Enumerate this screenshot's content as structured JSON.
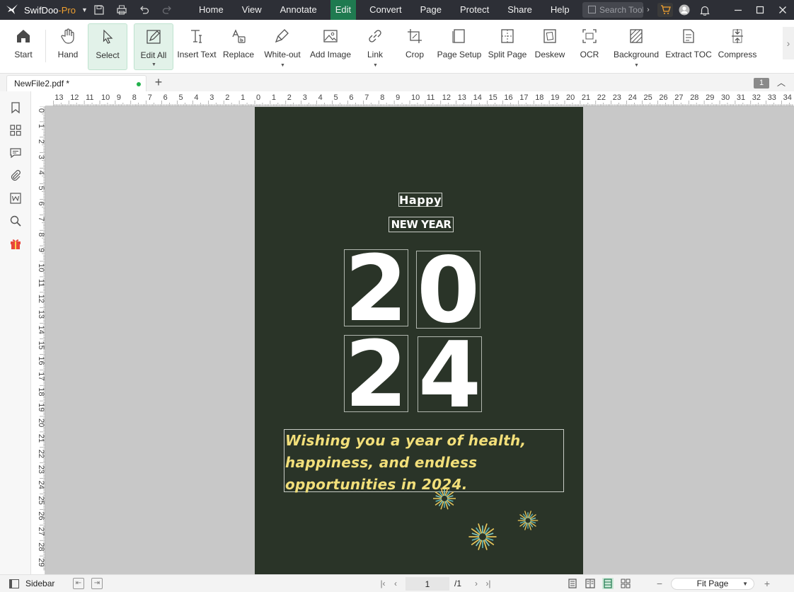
{
  "app": {
    "name": "SwifDoo",
    "edition": "-Pro"
  },
  "menu": [
    "Home",
    "View",
    "Annotate",
    "Edit",
    "Convert",
    "Page",
    "Protect",
    "Share",
    "Help"
  ],
  "active_menu": "Edit",
  "search": {
    "placeholder": "Search Tools"
  },
  "ribbon": {
    "tools": [
      {
        "label": "Start",
        "icon": "home-icon"
      },
      {
        "label": "Hand",
        "icon": "hand-icon"
      },
      {
        "label": "Select",
        "icon": "cursor-icon"
      },
      {
        "label": "Edit All",
        "icon": "edit-icon"
      },
      {
        "label": "Insert Text",
        "icon": "insert-text-icon"
      },
      {
        "label": "Replace",
        "icon": "replace-icon"
      },
      {
        "label": "White-out",
        "icon": "white-out-icon"
      },
      {
        "label": "Add Image",
        "icon": "image-icon"
      },
      {
        "label": "Link",
        "icon": "link-icon"
      },
      {
        "label": "Crop",
        "icon": "crop-icon"
      },
      {
        "label": "Page Setup",
        "icon": "page-setup-icon"
      },
      {
        "label": "Split Page",
        "icon": "split-page-icon"
      },
      {
        "label": "Deskew",
        "icon": "deskew-icon"
      },
      {
        "label": "OCR",
        "icon": "ocr-icon"
      },
      {
        "label": "Background",
        "icon": "background-icon"
      },
      {
        "label": "Extract TOC",
        "icon": "extract-toc-icon"
      },
      {
        "label": "Compress",
        "icon": "compress-icon"
      }
    ]
  },
  "tab": {
    "title": "NewFile2.pdf *"
  },
  "page_badge": "1",
  "ruler": {
    "top_labels": [
      "13",
      "12",
      "11",
      "10",
      "9",
      "8",
      "7",
      "6",
      "5",
      "4",
      "3",
      "2",
      "1",
      "0",
      "1",
      "2",
      "3",
      "4",
      "5",
      "6",
      "7",
      "8",
      "9",
      "10",
      "11",
      "12",
      "13",
      "14",
      "15",
      "16",
      "17",
      "18",
      "19",
      "20",
      "21",
      "22",
      "23",
      "24",
      "25",
      "26",
      "27",
      "28",
      "29",
      "30",
      "31",
      "32",
      "33",
      "34"
    ],
    "left_labels": [
      "0",
      "1",
      "2",
      "3",
      "4",
      "5",
      "6",
      "7",
      "8",
      "9",
      "10",
      "11",
      "12",
      "13",
      "14",
      "15",
      "16",
      "17",
      "18",
      "19",
      "20",
      "21",
      "22",
      "23",
      "24",
      "25",
      "26",
      "27",
      "28",
      "29"
    ]
  },
  "document": {
    "happy": "Happy",
    "new_year": "NEW YEAR",
    "digits": [
      "2",
      "0",
      "2",
      "4"
    ],
    "greeting": "Wishing you a year of health, happiness, and endless opportunities in 2024.",
    "page_color": "#2a3428",
    "greeting_color": "#f2df7a"
  },
  "statusbar": {
    "sidebar_label": "Sidebar",
    "current_page": "1",
    "total_pages": "/1",
    "zoom": "Fit Page"
  },
  "colors": {
    "titlebar": "#2d2f36",
    "accent": "#1f7a50",
    "pro_badge": "#f0a030"
  }
}
